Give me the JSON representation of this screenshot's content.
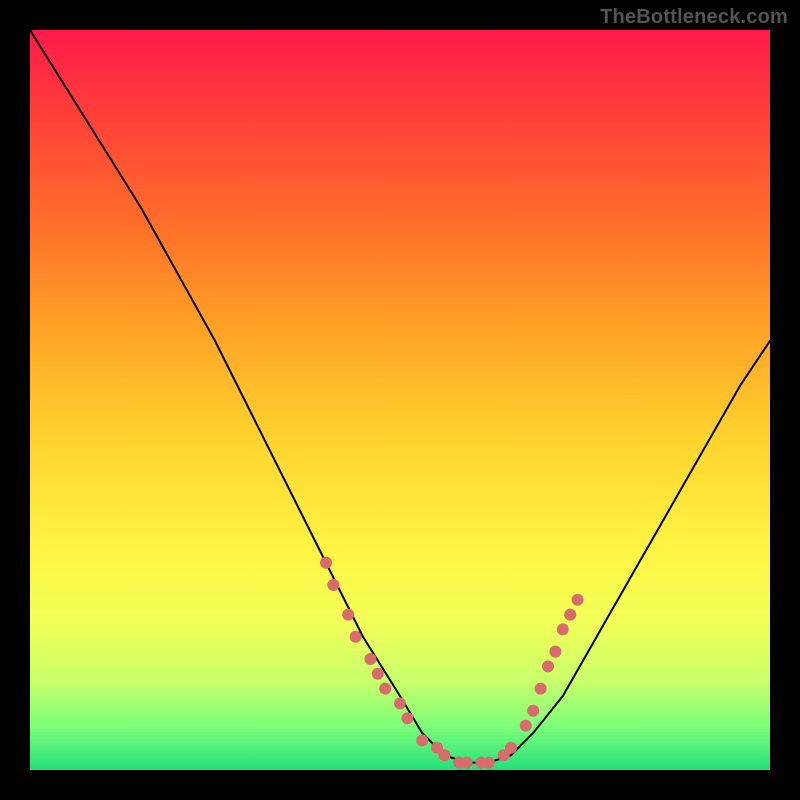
{
  "watermark": "TheBottleneck.com",
  "chart_data": {
    "type": "line",
    "title": "",
    "xlabel": "",
    "ylabel": "",
    "xlim": [
      0,
      100
    ],
    "ylim": [
      0,
      100
    ],
    "series": [
      {
        "name": "curve",
        "x": [
          0,
          5,
          10,
          15,
          20,
          25,
          30,
          35,
          40,
          45,
          50,
          53,
          56,
          59,
          62,
          65,
          68,
          72,
          76,
          80,
          84,
          88,
          92,
          96,
          100
        ],
        "values": [
          100,
          92,
          84,
          76,
          67,
          58,
          48,
          38,
          28,
          18,
          10,
          5,
          2,
          1,
          1,
          2,
          5,
          10,
          17,
          24,
          31,
          38,
          45,
          52,
          58
        ]
      }
    ],
    "dot_clusters": [
      {
        "name": "left-cluster",
        "color": "#d86b6b",
        "points": [
          {
            "x": 40,
            "y": 28
          },
          {
            "x": 41,
            "y": 25
          },
          {
            "x": 43,
            "y": 21
          },
          {
            "x": 44,
            "y": 18
          },
          {
            "x": 46,
            "y": 15
          },
          {
            "x": 47,
            "y": 13
          },
          {
            "x": 48,
            "y": 11
          },
          {
            "x": 50,
            "y": 9
          },
          {
            "x": 51,
            "y": 7
          }
        ]
      },
      {
        "name": "bottom-cluster",
        "color": "#d86b6b",
        "points": [
          {
            "x": 53,
            "y": 4
          },
          {
            "x": 55,
            "y": 3
          },
          {
            "x": 56,
            "y": 2
          },
          {
            "x": 58,
            "y": 1
          },
          {
            "x": 59,
            "y": 1
          },
          {
            "x": 61,
            "y": 1
          },
          {
            "x": 62,
            "y": 1
          },
          {
            "x": 64,
            "y": 2
          },
          {
            "x": 65,
            "y": 3
          }
        ]
      },
      {
        "name": "right-cluster",
        "color": "#d86b6b",
        "points": [
          {
            "x": 67,
            "y": 6
          },
          {
            "x": 68,
            "y": 8
          },
          {
            "x": 69,
            "y": 11
          },
          {
            "x": 70,
            "y": 14
          },
          {
            "x": 71,
            "y": 16
          },
          {
            "x": 72,
            "y": 19
          },
          {
            "x": 73,
            "y": 21
          },
          {
            "x": 74,
            "y": 23
          }
        ]
      }
    ]
  }
}
